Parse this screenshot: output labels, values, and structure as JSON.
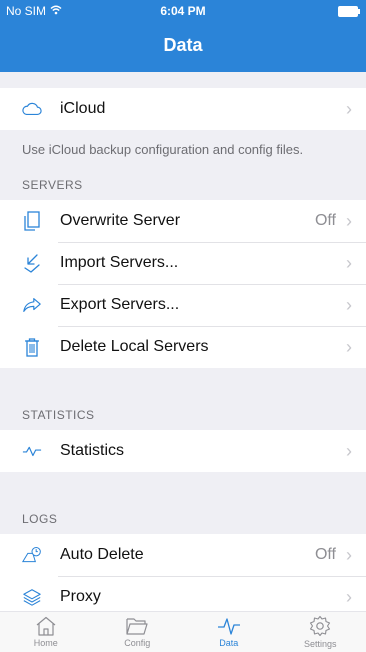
{
  "status": {
    "carrier": "No SIM",
    "time": "6:04 PM"
  },
  "nav": {
    "title": "Data"
  },
  "icloud": {
    "label": "iCloud",
    "note": "Use iCloud backup configuration and config files."
  },
  "servers": {
    "header": "SERVERS",
    "items": [
      {
        "label": "Overwrite Server",
        "value": "Off",
        "icon": "copy-icon"
      },
      {
        "label": "Import Servers...",
        "icon": "import-icon"
      },
      {
        "label": "Export Servers...",
        "icon": "export-icon"
      },
      {
        "label": "Delete Local Servers",
        "icon": "trash-icon"
      }
    ]
  },
  "statistics": {
    "header": "STATISTICS",
    "label": "Statistics",
    "icon": "pulse-icon"
  },
  "logs": {
    "header": "LOGS",
    "items": [
      {
        "label": "Auto Delete",
        "value": "Off",
        "icon": "auto-delete-icon"
      },
      {
        "label": "Proxy",
        "icon": "layers-icon"
      }
    ]
  },
  "tabs": [
    {
      "label": "Home"
    },
    {
      "label": "Config"
    },
    {
      "label": "Data"
    },
    {
      "label": "Settings"
    }
  ],
  "colors": {
    "accent": "#2b84d8",
    "separator": "#e2e2e6",
    "secondary_text": "#6d6d72"
  }
}
